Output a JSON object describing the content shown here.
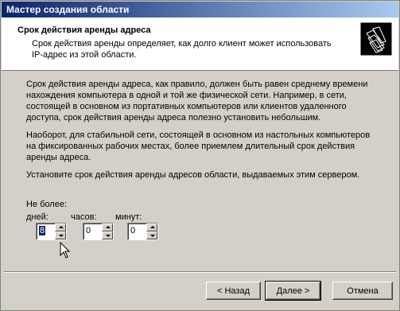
{
  "window": {
    "title": "Мастер создания области"
  },
  "header": {
    "title": "Срок действия аренды адреса",
    "description": "Срок действия аренды определяет, как долго клиент может использовать IP-адрес из этой области."
  },
  "body": {
    "paragraphs": [
      "Срок действия аренды адреса, как правило, должен быть равен среднему времени нахождения компьютера в одной и той же физической сети. Например, в сети, состоящей в основном из портативных компьютеров или клиентов удаленного доступа, срок действия аренды адреса полезно установить небольшим.",
      "Наоборот, для стабильной сети, состоящей в основном из настольных компьютеров на фиксированных рабочих местах, более приемлем длительный срок действия аренды адреса.",
      "Установите срок действия аренды адресов области, выдаваемых этим сервером."
    ]
  },
  "limits": {
    "label": "Не более:",
    "days": {
      "label": "дней:",
      "value": "8"
    },
    "hours": {
      "label": "часов:",
      "value": "0"
    },
    "minutes": {
      "label": "минут:",
      "value": "0"
    }
  },
  "buttons": {
    "back": "< Назад",
    "next": "Далее >",
    "cancel": "Отмена"
  },
  "icons": {
    "header": "folders-icon"
  },
  "colors": {
    "titlebar": "#0a246a",
    "face": "#d4d0c8"
  }
}
